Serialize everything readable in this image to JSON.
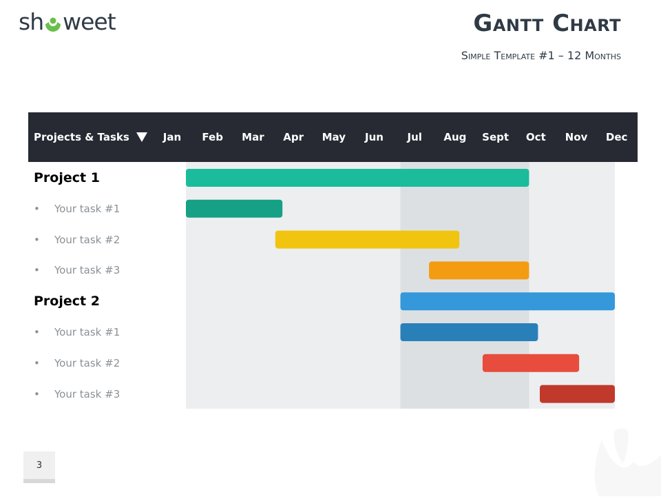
{
  "logo": {
    "text": "showeet",
    "accent": "#6abf4b"
  },
  "title": "Gantt Chart",
  "subtitle": "Simple Template #1 – 12 Months",
  "page_number": "3",
  "header": {
    "label": "Projects & Tasks",
    "dropdown_icon": "triangle-down-icon",
    "background": "#272a33"
  },
  "chart_data": {
    "type": "gantt",
    "months": [
      "Jan",
      "Feb",
      "Mar",
      "Apr",
      "May",
      "Jun",
      "Jul",
      "Aug",
      "Sept",
      "Oct",
      "Nov",
      "Dec"
    ],
    "x_unit": "months from start of Jan",
    "xlim": [
      0,
      12
    ],
    "highlight_band": {
      "start": 6,
      "end": 9.6,
      "color": "#dde0e3"
    },
    "background_color": "#eceef0",
    "rows": [
      {
        "label": "Project 1",
        "kind": "project",
        "start": 0,
        "end": 9.6,
        "color": "#1abc9c"
      },
      {
        "label": "Your task #1",
        "kind": "task",
        "start": 0,
        "end": 2.7,
        "color": "#16a085"
      },
      {
        "label": "Your task #2",
        "kind": "task",
        "start": 2.5,
        "end": 7.65,
        "color": "#f1c40f"
      },
      {
        "label": "Your task #3",
        "kind": "task",
        "start": 6.8,
        "end": 9.6,
        "color": "#f39c12"
      },
      {
        "label": "Project 2",
        "kind": "project",
        "start": 6,
        "end": 12,
        "color": "#3498db"
      },
      {
        "label": "Your task #1",
        "kind": "task",
        "start": 6,
        "end": 9.85,
        "color": "#2980b9"
      },
      {
        "label": "Your task #2",
        "kind": "task",
        "start": 8.3,
        "end": 11,
        "color": "#e74c3c"
      },
      {
        "label": "Your task #3",
        "kind": "task",
        "start": 9.9,
        "end": 12,
        "color": "#c0392b"
      }
    ],
    "bullet": "•"
  }
}
